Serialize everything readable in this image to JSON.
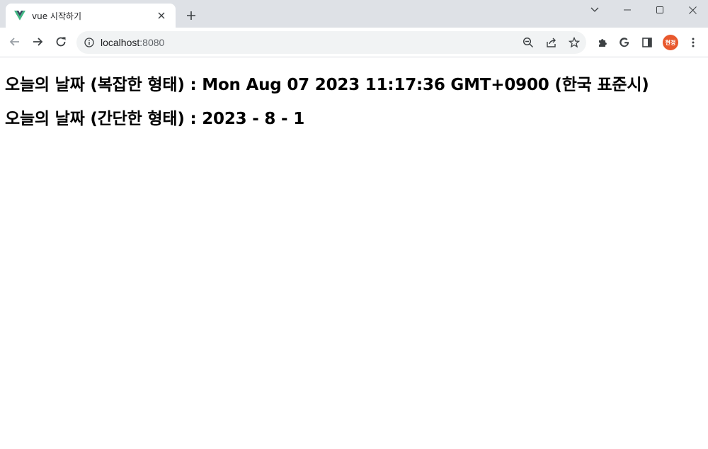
{
  "browser": {
    "tab_title": "vue 시작하기",
    "url_host": "localhost",
    "url_port": ":8080",
    "avatar_text": "현정",
    "icons": {
      "favicon": "vue-logo-icon",
      "close": "close-icon",
      "new_tab": "plus-icon",
      "back": "arrow-left-icon",
      "forward": "arrow-right-icon",
      "reload": "reload-icon",
      "info": "info-icon",
      "zoom": "zoom-out-icon",
      "share": "share-icon",
      "bookmark": "star-icon",
      "extensions": "puzzle-icon",
      "google": "google-icon",
      "sidepanel": "side-panel-icon",
      "menu": "kebab-menu-icon"
    }
  },
  "content": {
    "line1": "오늘의 날짜 (복잡한 형태) : Mon Aug 07 2023 11:17:36 GMT+0900 (한국 표준시)",
    "line2": "오늘의 날짜 (간단한 형태) : 2023 - 8 - 1"
  },
  "colors": {
    "tabstrip_bg": "#dee1e6",
    "omnibox_bg": "#f1f3f4",
    "vue_green": "#41b883",
    "vue_dark": "#35495e",
    "avatar_bg": "#e8582d"
  }
}
